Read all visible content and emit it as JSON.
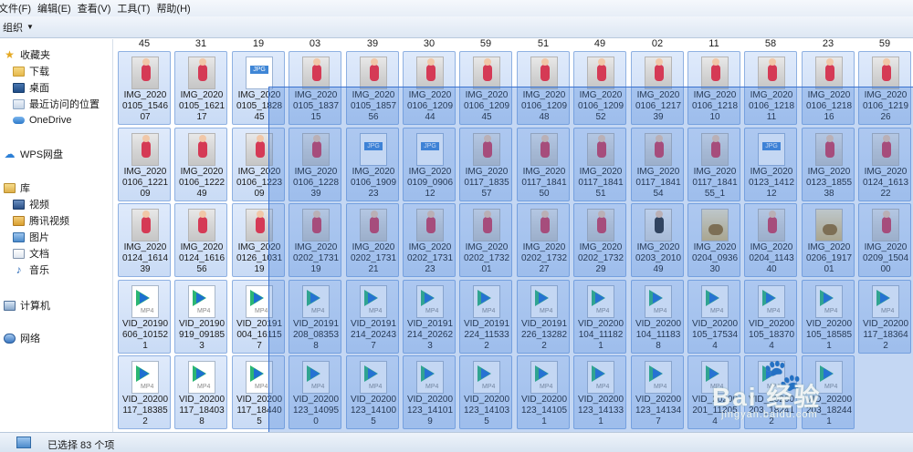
{
  "menubar": {
    "items": [
      "文件(F)",
      "编辑(E)",
      "查看(V)",
      "工具(T)",
      "帮助(H)"
    ]
  },
  "toolbar": {
    "organize_label": "组织"
  },
  "sidebar": {
    "favorites_label": "收藏夹",
    "favorites": [
      "下载",
      "桌面",
      "最近访问的位置",
      "OneDrive"
    ],
    "wps_label": "WPS网盘",
    "libraries_label": "库",
    "libraries": [
      "视频",
      "腾讯视频",
      "图片",
      "文档",
      "音乐"
    ],
    "computer_label": "计算机",
    "network_label": "网络"
  },
  "files": {
    "top_numbers": [
      "45",
      "31",
      "19",
      "03",
      "39",
      "30",
      "59",
      "51",
      "49",
      "02",
      "11",
      "58",
      "23",
      "59"
    ],
    "rows": [
      [
        {
          "type": "photo",
          "l1": "IMG_2020",
          "l2": "0105_1546",
          "l3": "07"
        },
        {
          "type": "photo",
          "l1": "IMG_2020",
          "l2": "0105_1621",
          "l3": "17"
        },
        {
          "type": "jpg",
          "l1": "IMG_2020",
          "l2": "0105_1828",
          "l3": "45"
        },
        {
          "type": "photo",
          "l1": "IMG_2020",
          "l2": "0105_1837",
          "l3": "15"
        },
        {
          "type": "photo",
          "l1": "IMG_2020",
          "l2": "0105_1857",
          "l3": "56"
        },
        {
          "type": "photo",
          "l1": "IMG_2020",
          "l2": "0106_1209",
          "l3": "44"
        },
        {
          "type": "photo",
          "l1": "IMG_2020",
          "l2": "0106_1209",
          "l3": "45"
        },
        {
          "type": "photo",
          "l1": "IMG_2020",
          "l2": "0106_1209",
          "l3": "48"
        },
        {
          "type": "photo",
          "l1": "IMG_2020",
          "l2": "0106_1209",
          "l3": "52"
        },
        {
          "type": "photo",
          "l1": "IMG_2020",
          "l2": "0106_1217",
          "l3": "39"
        },
        {
          "type": "photo",
          "l1": "IMG_2020",
          "l2": "0106_1218",
          "l3": "10"
        },
        {
          "type": "photo",
          "l1": "IMG_2020",
          "l2": "0106_1218",
          "l3": "11"
        },
        {
          "type": "photo",
          "l1": "IMG_2020",
          "l2": "0106_1218",
          "l3": "16"
        },
        {
          "type": "photo",
          "l1": "IMG_2020",
          "l2": "0106_1219",
          "l3": "26"
        }
      ],
      [
        {
          "type": "photo",
          "l1": "IMG_2020",
          "l2": "0106_1221",
          "l3": "09"
        },
        {
          "type": "photo",
          "l1": "IMG_2020",
          "l2": "0106_1222",
          "l3": "49"
        },
        {
          "type": "photo",
          "l1": "IMG_2020",
          "l2": "0106_1223",
          "l3": "09"
        },
        {
          "type": "photo",
          "l1": "IMG_2020",
          "l2": "0106_1228",
          "l3": "39"
        },
        {
          "type": "jpg",
          "l1": "IMG_2020",
          "l2": "0106_1909",
          "l3": "23"
        },
        {
          "type": "jpg",
          "l1": "IMG_2020",
          "l2": "0109_0906",
          "l3": "12"
        },
        {
          "type": "photo",
          "l1": "IMG_2020",
          "l2": "0117_1835",
          "l3": "57"
        },
        {
          "type": "photo",
          "l1": "IMG_2020",
          "l2": "0117_1841",
          "l3": "50"
        },
        {
          "type": "photo",
          "l1": "IMG_2020",
          "l2": "0117_1841",
          "l3": "51"
        },
        {
          "type": "photo",
          "l1": "IMG_2020",
          "l2": "0117_1841",
          "l3": "54"
        },
        {
          "type": "photo",
          "l1": "IMG_2020",
          "l2": "0117_1841",
          "l3": "55_1"
        },
        {
          "type": "jpg",
          "l1": "IMG_2020",
          "l2": "0123_1412",
          "l3": "12"
        },
        {
          "type": "photo",
          "l1": "IMG_2020",
          "l2": "0123_1855",
          "l3": "38"
        },
        {
          "type": "photo",
          "l1": "IMG_2020",
          "l2": "0124_1613",
          "l3": "22"
        }
      ],
      [
        {
          "type": "photo",
          "l1": "IMG_2020",
          "l2": "0124_1614",
          "l3": "39"
        },
        {
          "type": "photo",
          "l1": "IMG_2020",
          "l2": "0124_1616",
          "l3": "56"
        },
        {
          "type": "photo",
          "l1": "IMG_2020",
          "l2": "0126_1031",
          "l3": "19"
        },
        {
          "type": "photo",
          "l1": "IMG_2020",
          "l2": "0202_1731",
          "l3": "19"
        },
        {
          "type": "photo",
          "l1": "IMG_2020",
          "l2": "0202_1731",
          "l3": "21"
        },
        {
          "type": "photo",
          "l1": "IMG_2020",
          "l2": "0202_1731",
          "l3": "23"
        },
        {
          "type": "photo",
          "l1": "IMG_2020",
          "l2": "0202_1732",
          "l3": "01"
        },
        {
          "type": "photo",
          "l1": "IMG_2020",
          "l2": "0202_1732",
          "l3": "27"
        },
        {
          "type": "photo",
          "l1": "IMG_2020",
          "l2": "0202_1732",
          "l3": "29"
        },
        {
          "type": "white",
          "l1": "IMG_2020",
          "l2": "0203_2010",
          "l3": "49"
        },
        {
          "type": "food",
          "l1": "IMG_2020",
          "l2": "0204_0936",
          "l3": "30"
        },
        {
          "type": "photo",
          "l1": "IMG_2020",
          "l2": "0204_1143",
          "l3": "40"
        },
        {
          "type": "food",
          "l1": "IMG_2020",
          "l2": "0206_1917",
          "l3": "01"
        },
        {
          "type": "photo",
          "l1": "IMG_2020",
          "l2": "0209_1504",
          "l3": "00"
        }
      ],
      [
        {
          "type": "mp4",
          "l1": "VID_20190",
          "l2": "606_10152",
          "l3": "1"
        },
        {
          "type": "mp4",
          "l1": "VID_20190",
          "l2": "919_09185",
          "l3": "3"
        },
        {
          "type": "mp4",
          "l1": "VID_20191",
          "l2": "004_16115",
          "l3": "7"
        },
        {
          "type": "mp4",
          "l1": "VID_20191",
          "l2": "208_08353",
          "l3": "8"
        },
        {
          "type": "mp4",
          "l1": "VID_20191",
          "l2": "214_20243",
          "l3": "7"
        },
        {
          "type": "mp4",
          "l1": "VID_20191",
          "l2": "214_20262",
          "l3": "3"
        },
        {
          "type": "mp4",
          "l1": "VID_20191",
          "l2": "224_11533",
          "l3": "2"
        },
        {
          "type": "mp4",
          "l1": "VID_20191",
          "l2": "226_13282",
          "l3": "2"
        },
        {
          "type": "mp4",
          "l1": "VID_20200",
          "l2": "104_11182",
          "l3": "1"
        },
        {
          "type": "mp4",
          "l1": "VID_20200",
          "l2": "104_11183",
          "l3": "8"
        },
        {
          "type": "mp4",
          "l1": "VID_20200",
          "l2": "105_17534",
          "l3": "4"
        },
        {
          "type": "mp4",
          "l1": "VID_20200",
          "l2": "105_18370",
          "l3": "4"
        },
        {
          "type": "mp4",
          "l1": "VID_20200",
          "l2": "105_18585",
          "l3": "1"
        },
        {
          "type": "mp4",
          "l1": "VID_20200",
          "l2": "117_18364",
          "l3": "2"
        }
      ],
      [
        {
          "type": "mp4",
          "l1": "VID_20200",
          "l2": "117_18385",
          "l3": "2"
        },
        {
          "type": "mp4",
          "l1": "VID_20200",
          "l2": "117_18403",
          "l3": "8"
        },
        {
          "type": "mp4",
          "l1": "VID_20200",
          "l2": "117_18440",
          "l3": "5"
        },
        {
          "type": "mp4",
          "l1": "VID_20200",
          "l2": "123_14095",
          "l3": "0"
        },
        {
          "type": "mp4",
          "l1": "VID_20200",
          "l2": "123_14100",
          "l3": "5"
        },
        {
          "type": "mp4",
          "l1": "VID_20200",
          "l2": "123_14101",
          "l3": "9"
        },
        {
          "type": "mp4",
          "l1": "VID_20200",
          "l2": "123_14103",
          "l3": "5"
        },
        {
          "type": "mp4",
          "l1": "VID_20200",
          "l2": "123_14105",
          "l3": "1"
        },
        {
          "type": "mp4",
          "l1": "VID_20200",
          "l2": "123_14133",
          "l3": "1"
        },
        {
          "type": "mp4",
          "l1": "VID_20200",
          "l2": "123_14134",
          "l3": "7"
        },
        {
          "type": "mp4",
          "l1": "VID_20200",
          "l2": "201_11205",
          "l3": "4"
        },
        {
          "type": "mp4",
          "l1": "VID_20200",
          "l2": "203_18241",
          "l3": "2"
        },
        {
          "type": "mp4",
          "l1": "VID_20200",
          "l2": "203_18244",
          "l3": "1"
        }
      ]
    ]
  },
  "status": {
    "selected_text": "已选择 83 个项"
  },
  "watermark": {
    "brand": "Bai 经验",
    "url": "jingyan.baidu.com"
  }
}
